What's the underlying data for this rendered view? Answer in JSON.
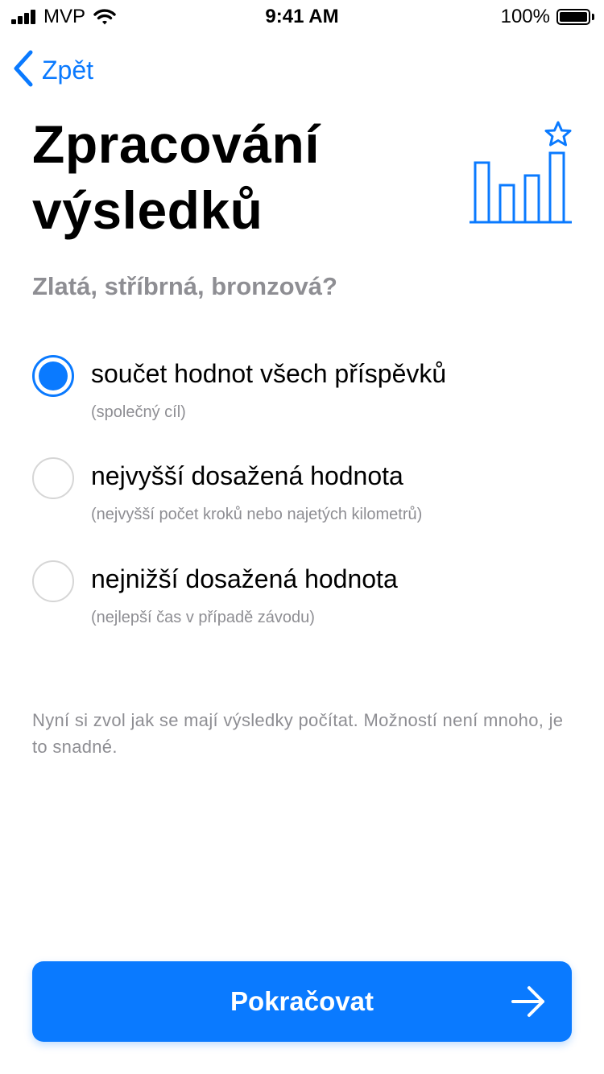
{
  "status_bar": {
    "carrier": "MVP",
    "time": "9:41 AM",
    "battery": "100%",
    "icons": [
      "signal-icon",
      "wifi-icon",
      "battery-icon"
    ]
  },
  "nav": {
    "back_label": "Zpět",
    "back_icon": "chevron-left-icon"
  },
  "header": {
    "title": "Zpracování výsledků",
    "icon": "bar-chart-star-icon"
  },
  "question": "Zlatá, stříbrná, bronzová?",
  "options": [
    {
      "label": "součet hodnot všech příspěvků",
      "note": "(společný cíl)",
      "selected": true
    },
    {
      "label": "nejvyšší dosažená hodnota",
      "note": "(nejvyšší počet kroků nebo najetých kilometrů)",
      "selected": false
    },
    {
      "label": "nejnižší dosažená hodnota",
      "note": "(nejlepší čas v případě závodu)",
      "selected": false
    }
  ],
  "info_text": "Nyní si zvol jak se mají výsledky počítat. Možností není mnoho, je to snadné.",
  "continue_button": {
    "label": "Pokračovat",
    "icon": "arrow-right-icon"
  },
  "colors": {
    "accent": "#0a7aff",
    "secondary_text": "#8e8e93",
    "radio_border": "#d6d6d6"
  }
}
